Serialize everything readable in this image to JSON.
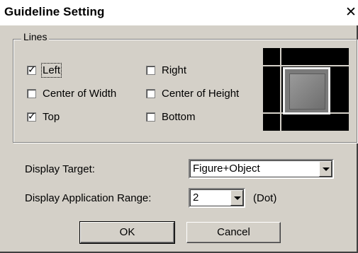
{
  "window": {
    "title": "Guideline Setting",
    "close_glyph": "✕"
  },
  "lines_group": {
    "label": "Lines",
    "checkboxes": [
      {
        "key": "left",
        "label": "Left",
        "checked": true
      },
      {
        "key": "right",
        "label": "Right",
        "checked": false
      },
      {
        "key": "center_width",
        "label": "Center of Width",
        "checked": false
      },
      {
        "key": "center_height",
        "label": "Center of Height",
        "checked": false
      },
      {
        "key": "top",
        "label": "Top",
        "checked": true
      },
      {
        "key": "bottom",
        "label": "Bottom",
        "checked": false
      }
    ]
  },
  "display_target": {
    "label": "Display Target:",
    "value": "Figure+Object"
  },
  "display_range": {
    "label": "Display Application Range:",
    "value": "2",
    "unit": "(Dot)"
  },
  "buttons": {
    "ok": "OK",
    "cancel": "Cancel"
  },
  "icons": {
    "close": "close-icon",
    "dropdown": "chevron-down-icon",
    "check": "check-icon"
  }
}
